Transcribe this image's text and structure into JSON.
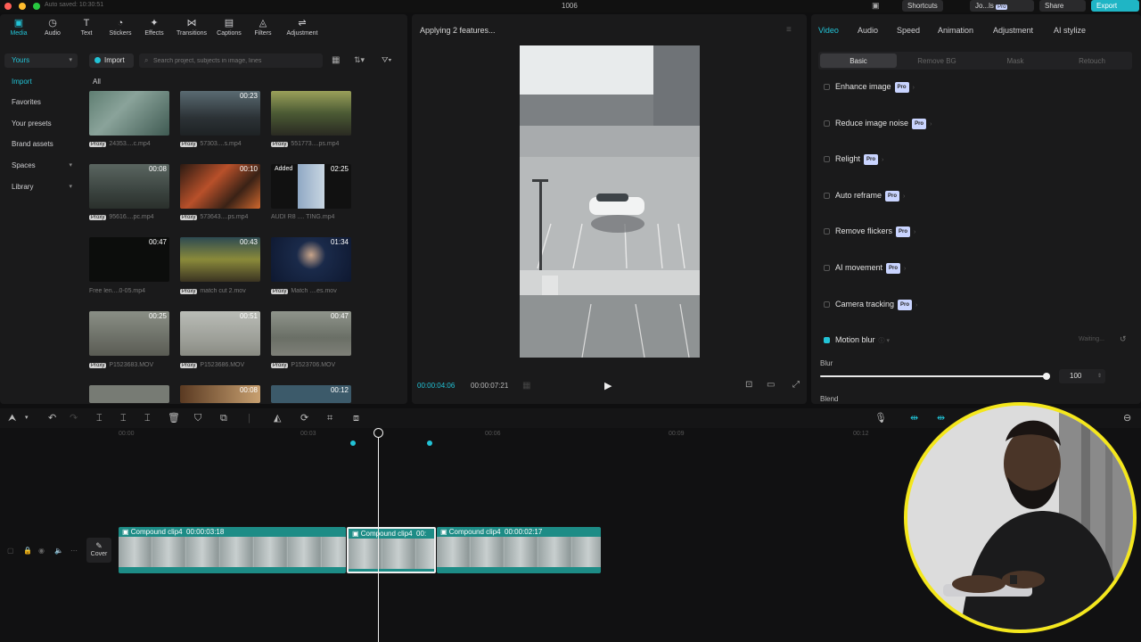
{
  "titlebar": {
    "saved": "Auto saved: 10:30:51",
    "title": "1006",
    "shortcuts": "Shortcuts",
    "user": "Jo...ls",
    "user_badge": "Pro",
    "share": "Share",
    "export": "Export"
  },
  "media_toolbar": {
    "tabs": [
      {
        "label": "Media",
        "icon": "media-icon"
      },
      {
        "label": "Audio",
        "icon": "audio-icon"
      },
      {
        "label": "Text",
        "icon": "text-icon"
      },
      {
        "label": "Stickers",
        "icon": "stickers-icon"
      },
      {
        "label": "Effects",
        "icon": "effects-icon"
      },
      {
        "label": "Transitions",
        "icon": "transitions-icon"
      },
      {
        "label": "Captions",
        "icon": "captions-icon"
      },
      {
        "label": "Filters",
        "icon": "filters-icon"
      },
      {
        "label": "Adjustment",
        "icon": "adjustment-icon"
      }
    ]
  },
  "sidebar": {
    "items": [
      {
        "label": "Yours"
      },
      {
        "label": "Import"
      },
      {
        "label": "Favorites"
      },
      {
        "label": "Your presets"
      },
      {
        "label": "Brand assets"
      },
      {
        "label": "Spaces"
      },
      {
        "label": "Library"
      }
    ]
  },
  "media": {
    "import_label": "Import",
    "search_placeholder": "Search project, subjects in image, lines",
    "filter_all": "All",
    "items": [
      {
        "name": "24353....c.mp4",
        "duration": "",
        "badge": "Proxy"
      },
      {
        "name": "57303....s.mp4",
        "duration": "00:23",
        "badge": "Proxy"
      },
      {
        "name": "551773....ps.mp4",
        "duration": "",
        "badge": "Proxy"
      },
      {
        "name": "95616....pc.mp4",
        "duration": "00:08",
        "badge": "Proxy"
      },
      {
        "name": "573643....ps.mp4",
        "duration": "00:10",
        "badge": "Proxy"
      },
      {
        "name": "AUDI R8 .... TING.mp4",
        "duration": "02:25",
        "badge": "",
        "added": "Added"
      },
      {
        "name": "Free len....0-05.mp4",
        "duration": "00:47",
        "badge": ""
      },
      {
        "name": "match cut 2.mov",
        "duration": "00:43",
        "badge": "Proxy"
      },
      {
        "name": "Match ....es.mov",
        "duration": "01:34",
        "badge": "Proxy"
      },
      {
        "name": "P1523683.MOV",
        "duration": "00:25",
        "badge": "Proxy"
      },
      {
        "name": "P1523686.MOV",
        "duration": "00:51",
        "badge": "Proxy"
      },
      {
        "name": "P1523706.MOV",
        "duration": "00:47",
        "badge": "Proxy"
      },
      {
        "name": "",
        "duration": "",
        "badge": ""
      },
      {
        "name": "",
        "duration": "00:08",
        "badge": ""
      },
      {
        "name": "",
        "duration": "00:12",
        "badge": ""
      }
    ]
  },
  "player": {
    "status": "Applying 2 features...",
    "current_time": "00:00:04:06",
    "total_time": "00:00:07:21"
  },
  "props": {
    "tabs": [
      "Video",
      "Audio",
      "Speed",
      "Animation",
      "Adjustment",
      "AI stylize"
    ],
    "segments": [
      "Basic",
      "Remove BG",
      "Mask",
      "Retouch"
    ],
    "pro_badge": "Pro",
    "features": [
      {
        "label": "Enhance image",
        "pro": true
      },
      {
        "label": "Reduce image noise",
        "pro": true
      },
      {
        "label": "Relight",
        "pro": true
      },
      {
        "label": "Auto reframe",
        "pro": true
      },
      {
        "label": "Remove flickers",
        "pro": true
      },
      {
        "label": "AI movement",
        "pro": true
      },
      {
        "label": "Camera tracking",
        "pro": true
      },
      {
        "label": "Motion blur",
        "pro": false
      }
    ],
    "waiting": "Waiting...",
    "blur_label": "Blur",
    "blur_value": "100",
    "blur_level": 1.0,
    "blend_label": "Blend"
  },
  "timeline": {
    "ticks": [
      "00:00",
      "00:03",
      "00:06",
      "00:09",
      "00:12"
    ],
    "cover_label": "Cover",
    "clips": [
      {
        "name": "Compound clip4",
        "duration": "00:00:03:18"
      },
      {
        "name": "Compound clip4",
        "duration": "00:"
      },
      {
        "name": "Compound clip4",
        "duration": "00:00:02:17"
      }
    ]
  },
  "colors": {
    "accent": "#22c3d6",
    "clip": "#1d8c86",
    "webcam_ring": "#f4e71c"
  }
}
